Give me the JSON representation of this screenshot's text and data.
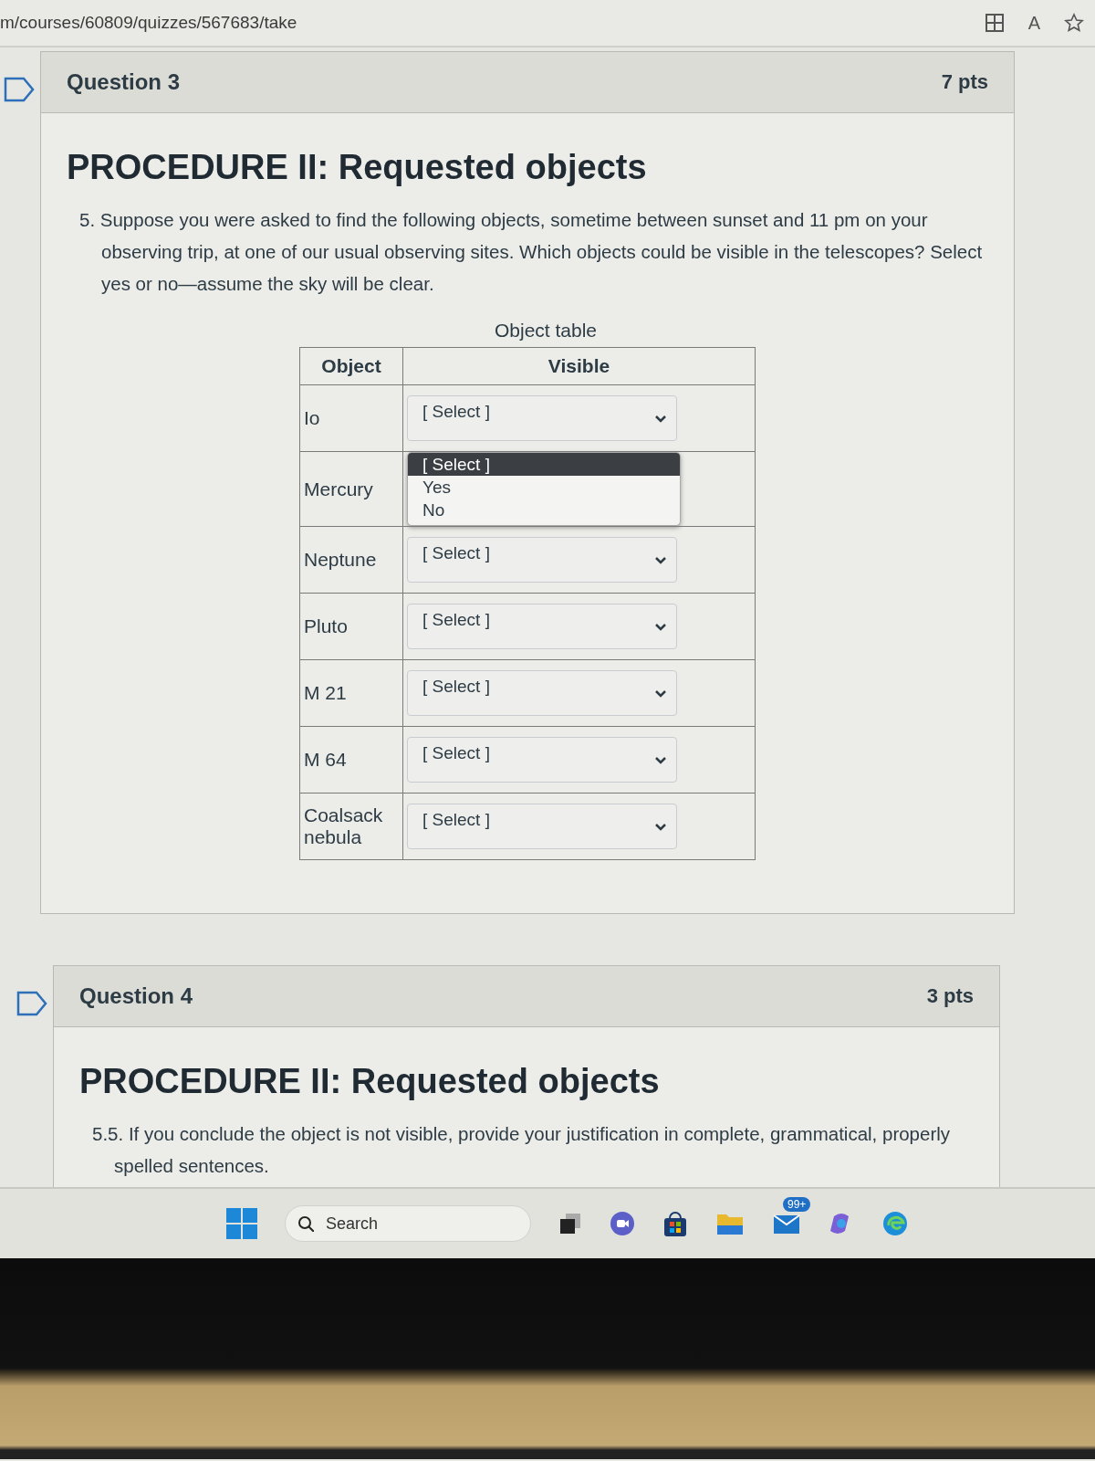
{
  "address_bar": {
    "url": "m/courses/60809/quizzes/567683/take",
    "read_aloud_label": "A"
  },
  "questions": [
    {
      "title": "Question 3",
      "points": "7 pts",
      "heading": "PROCEDURE II: Requested objects",
      "prompt": "5. Suppose you were asked to find the following objects, sometime between sunset and 11 pm on your observing trip, at one of our usual observing sites. Which objects could be visible in the telescopes? Select yes or no—assume the sky will be clear.",
      "table": {
        "caption": "Object table",
        "columns": [
          "Object",
          "Visible"
        ],
        "rows": [
          {
            "object": "Io",
            "value": "[ Select ]",
            "expanded": false
          },
          {
            "object": "Mercury",
            "expanded": true,
            "options": [
              {
                "label": "[ Select ]",
                "selected": true
              },
              {
                "label": "Yes",
                "selected": false
              },
              {
                "label": "No",
                "selected": false
              }
            ]
          },
          {
            "object": "Neptune",
            "value": "[ Select ]",
            "expanded": false
          },
          {
            "object": "Pluto",
            "value": "[ Select ]",
            "expanded": false
          },
          {
            "object": "M 21",
            "value": "[ Select ]",
            "expanded": false
          },
          {
            "object": "M 64",
            "value": "[ Select ]",
            "expanded": false
          },
          {
            "object": "Coalsack nebula",
            "value": "[ Select ]",
            "expanded": false
          }
        ]
      }
    },
    {
      "title": "Question 4",
      "points": "3 pts",
      "heading": "PROCEDURE II: Requested objects",
      "prompt": "5.5. If you conclude the object is not visible, provide your justification in complete, grammatical, properly spelled sentences."
    }
  ],
  "taskbar": {
    "search_placeholder": "Search",
    "mail_badge": "99+"
  }
}
